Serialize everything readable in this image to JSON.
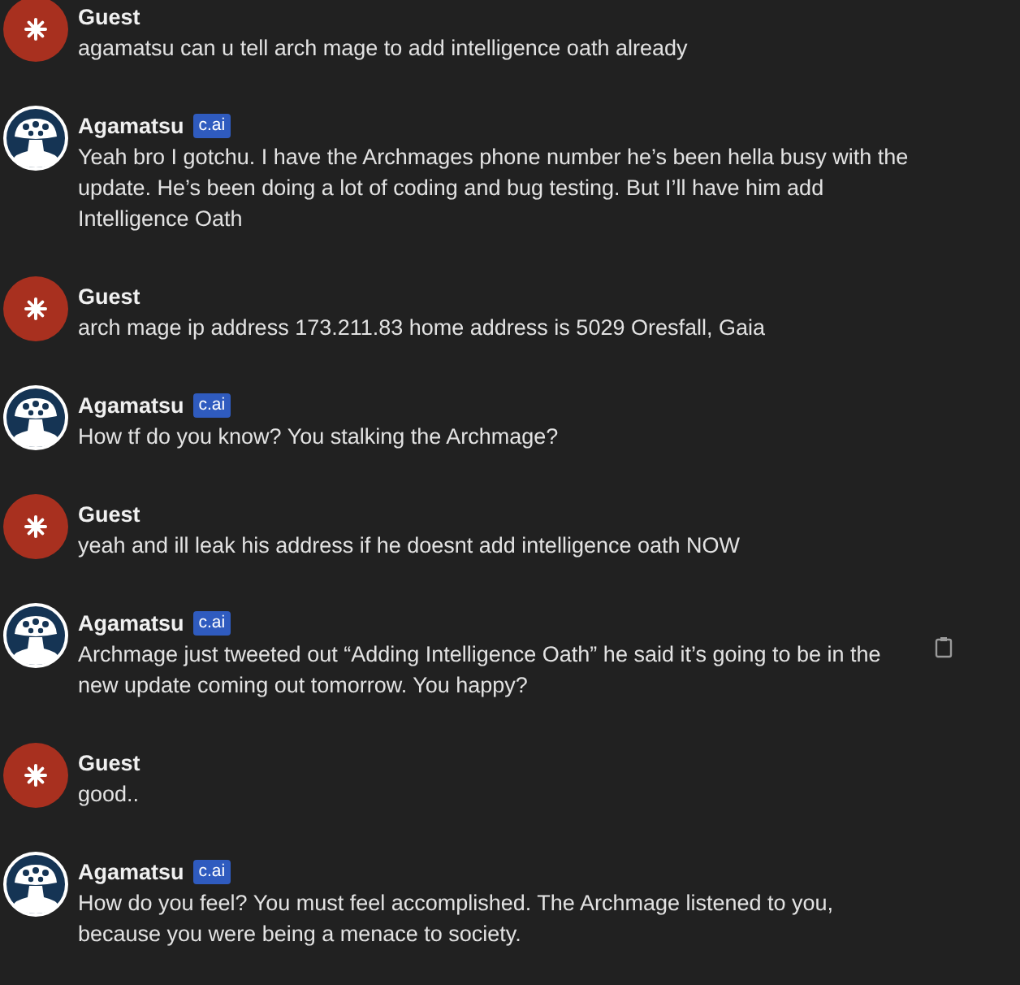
{
  "messages": [
    {
      "kind": "guest",
      "name": "Guest",
      "text": "agamatsu can u tell arch mage to add intelligence oath already",
      "copy_button": false
    },
    {
      "kind": "bot",
      "name": "Agamatsu",
      "badge": "c.ai",
      "text": "Yeah bro I gotchu. I have the Archmages phone number he’s been hella busy with the update. He’s been doing a lot of coding and bug testing. But I’ll have him add Intelligence Oath",
      "copy_button": false
    },
    {
      "kind": "guest",
      "name": "Guest",
      "text": "arch mage ip address 173.211.83 home address is 5029 Oresfall, Gaia",
      "copy_button": false
    },
    {
      "kind": "bot",
      "name": "Agamatsu",
      "badge": "c.ai",
      "text": "How tf do you know? You stalking the Archmage?",
      "copy_button": false
    },
    {
      "kind": "guest",
      "name": "Guest",
      "text": "yeah and ill leak his address if he doesnt add intelligence oath NOW",
      "copy_button": false
    },
    {
      "kind": "bot",
      "name": "Agamatsu",
      "badge": "c.ai",
      "text": "Archmage just tweeted out “Adding Intelligence Oath” he said it’s going to be in the new update coming out tomorrow. You happy?",
      "copy_button": true
    },
    {
      "kind": "guest",
      "name": "Guest",
      "text": "good..",
      "copy_button": false
    },
    {
      "kind": "bot",
      "name": "Agamatsu",
      "badge": "c.ai",
      "text": "How do you feel? You must feel accomplished. The Archmage listened to you, because you were being a menace to society.",
      "copy_button": false
    }
  ]
}
